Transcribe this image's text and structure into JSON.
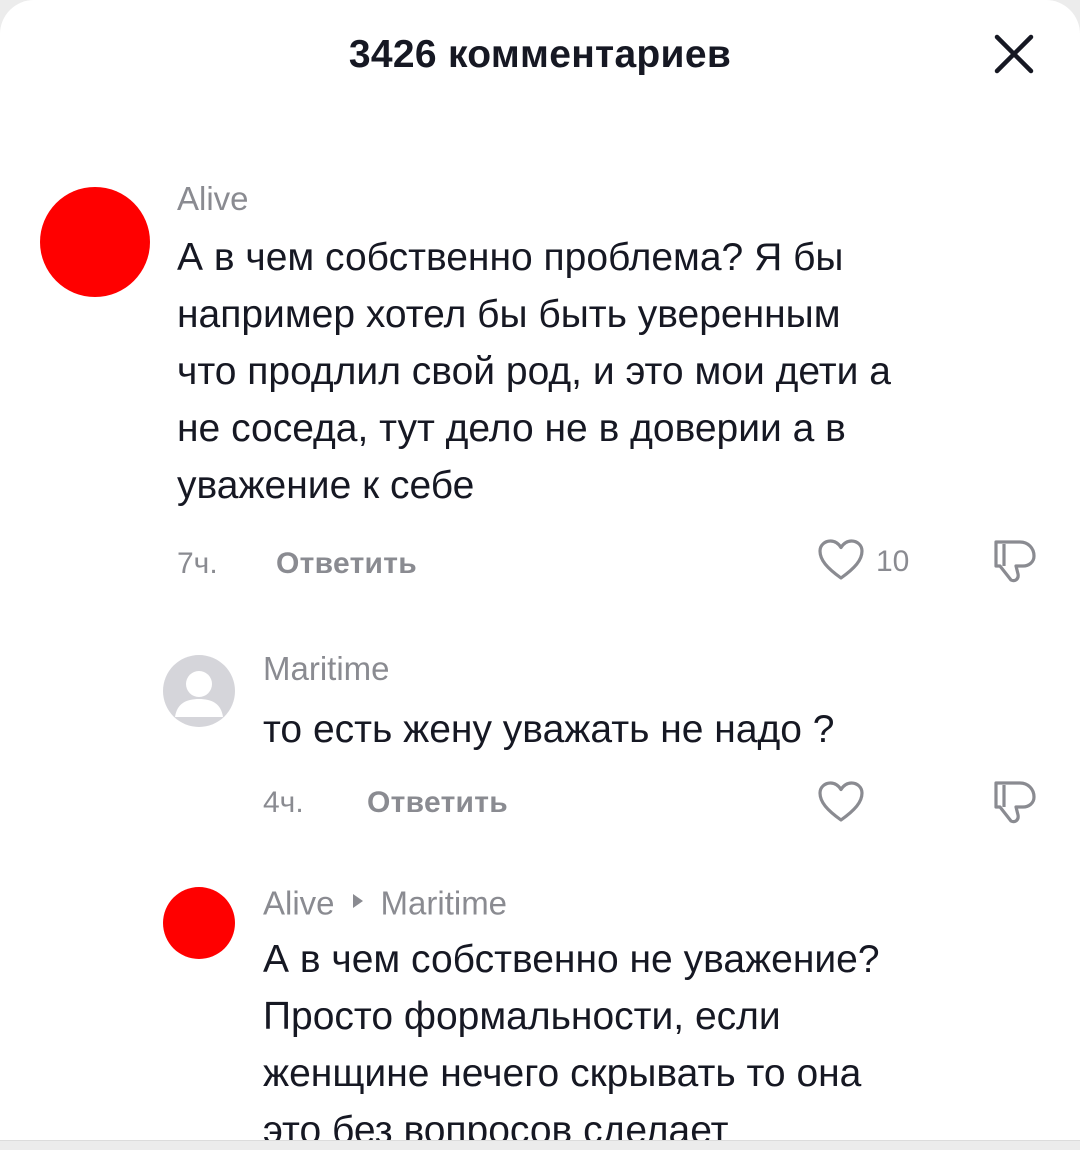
{
  "header": {
    "title": "3426 комментариев",
    "close_icon": "close-icon"
  },
  "comments": [
    {
      "username": "Alive",
      "avatar_color": "#ff0000",
      "text": "А в чем собственно проблема? Я бы\nнапример хотел бы быть уверенным\nчто продлил свой род, и это мои дети а\nне соседа, тут дело не в доверии а в\nуважение к себе",
      "time": "7ч.",
      "reply_label": "Ответить",
      "like_count": "10"
    },
    {
      "username": "Maritime",
      "avatar": "default-avatar-icon",
      "text": "то есть жену уважать не надо ?",
      "time": "4ч.",
      "reply_label": "Ответить"
    },
    {
      "username": "Alive",
      "reply_to": "Maritime",
      "avatar_color": "#ff0000",
      "text": "А в чем собственно не уважение?\nПросто формальности, если\nженщине нечего скрывать то она\nэто без вопросов сделает"
    }
  ],
  "colors": {
    "text_primary": "#161823",
    "text_secondary": "#8a8b91",
    "background": "#ffffff"
  }
}
